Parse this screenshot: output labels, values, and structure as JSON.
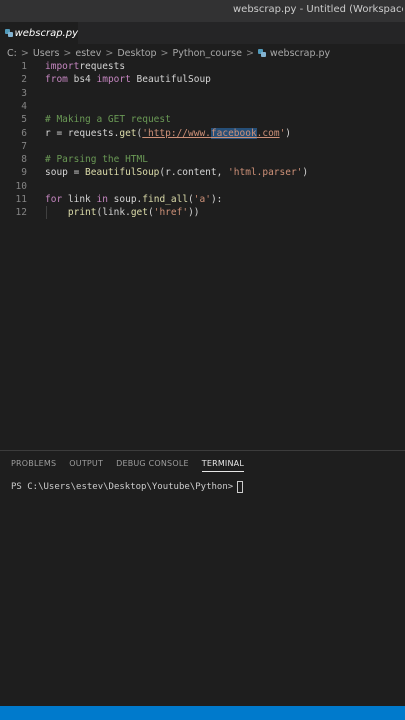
{
  "window": {
    "title": "webscrap.py - Untitled (Workspace)"
  },
  "tab": {
    "label": "webscrap.py",
    "icon": "python-file-icon"
  },
  "breadcrumb": {
    "parts": [
      "C:",
      "Users",
      "estev",
      "Desktop",
      "Python_course"
    ],
    "file": "webscrap.py",
    "separator": ">"
  },
  "editor": {
    "lines": [
      {
        "n": "1",
        "tokens": [
          [
            "kw",
            "import"
          ],
          [
            "",
            "requests"
          ]
        ]
      },
      {
        "n": "2",
        "tokens": [
          [
            "kw",
            "from"
          ],
          [
            "",
            " bs4 "
          ],
          [
            "kw",
            "import"
          ],
          [
            "",
            " BeautifulSoup"
          ]
        ]
      },
      {
        "n": "3",
        "tokens": []
      },
      {
        "n": "4",
        "tokens": []
      },
      {
        "n": "5",
        "tokens": [
          [
            "cm",
            "# Making a GET request"
          ]
        ]
      },
      {
        "n": "6",
        "tokens": [
          [
            "",
            "r = requests."
          ],
          [
            "fn",
            "get"
          ],
          [
            "",
            "("
          ],
          [
            "str url",
            "'http://www."
          ],
          [
            "str url sel",
            "facebook"
          ],
          [
            "str url",
            ".com"
          ],
          [
            "str",
            "'"
          ],
          [
            "",
            ")"
          ]
        ]
      },
      {
        "n": "7",
        "tokens": []
      },
      {
        "n": "8",
        "tokens": [
          [
            "cm",
            "# Parsing the HTML"
          ]
        ]
      },
      {
        "n": "9",
        "tokens": [
          [
            "",
            "soup = "
          ],
          [
            "fn",
            "BeautifulSoup"
          ],
          [
            "",
            "(r.content, "
          ],
          [
            "str",
            "'html.parser'"
          ],
          [
            "",
            ")"
          ]
        ]
      },
      {
        "n": "10",
        "tokens": []
      },
      {
        "n": "11",
        "tokens": [
          [
            "kw",
            "for"
          ],
          [
            "",
            " link "
          ],
          [
            "kw",
            "in"
          ],
          [
            "",
            " soup."
          ],
          [
            "fn",
            "find_all"
          ],
          [
            "",
            "("
          ],
          [
            "str",
            "'a'"
          ],
          [
            "",
            "):"
          ]
        ]
      },
      {
        "n": "12",
        "tokens": [
          [
            "",
            "    "
          ],
          [
            "fn",
            "print"
          ],
          [
            "",
            "(link."
          ],
          [
            "fn",
            "get"
          ],
          [
            "",
            "("
          ],
          [
            "str",
            "'href'"
          ],
          [
            "",
            "))"
          ]
        ]
      }
    ]
  },
  "panel": {
    "tabs": [
      "PROBLEMS",
      "OUTPUT",
      "DEBUG CONSOLE",
      "TERMINAL"
    ],
    "active_tab": "TERMINAL",
    "terminal_prompt": "PS C:\\Users\\estev\\Desktop\\Youtube\\Python>"
  },
  "colors": {
    "editor_bg": "#1e1e1e",
    "statusbar": "#007acc",
    "keyword": "#c586c0",
    "string": "#ce9178",
    "comment": "#6a9955",
    "function": "#dcdcaa"
  }
}
